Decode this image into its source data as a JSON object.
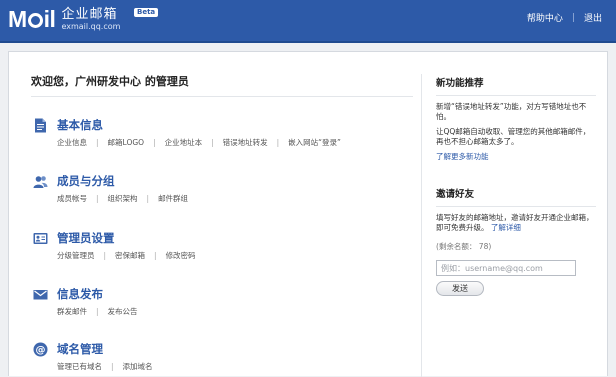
{
  "header": {
    "logo_domain": "exmail.qq.com",
    "logo_cn": "企业邮箱",
    "logo_mail": "M",
    "logo_mail_tail": "il",
    "beta": "Beta",
    "help_link": "帮助中心",
    "separator": "|",
    "logout_link": "退出"
  },
  "welcome": "欢迎您，广州研发中心 的管理员",
  "sections": [
    {
      "title": "基本信息",
      "icon": "document-icon",
      "links": [
        "企业信息",
        "邮箱LOGO",
        "企业地址本",
        "错误地址转发",
        "嵌入网站“登录”"
      ]
    },
    {
      "title": "成员与分组",
      "icon": "users-icon",
      "links": [
        "成员帐号",
        "组织架构",
        "邮件群组"
      ]
    },
    {
      "title": "管理员设置",
      "icon": "admin-card-icon",
      "links": [
        "分级管理员",
        "密保邮箱",
        "修改密码"
      ]
    },
    {
      "title": "信息发布",
      "icon": "envelope-icon",
      "links": [
        "群发邮件",
        "发布公告"
      ]
    },
    {
      "title": "域名管理",
      "icon": "at-sign-icon",
      "links": [
        "管理已有域名",
        "添加域名"
      ]
    }
  ],
  "new_features": {
    "title": "新功能推荐",
    "desc1": "新增“错误地址转发”功能，对方写错地址也不怕。",
    "desc2": "让QQ邮箱自动收取、管理您的其他邮箱邮件，再也不担心邮箱太多了。",
    "more_link": "了解更多新功能"
  },
  "invite": {
    "title": "邀请好友",
    "desc": "填写好友的邮箱地址，邀请好友开通企业邮箱，即可免费升级。",
    "detail_link": "了解详细",
    "remaining": "(剩余名额： 78)",
    "input_placeholder": "例如：username@qq.com",
    "send_label": "发送"
  },
  "colors": {
    "brand_blue": "#2d5aa8",
    "page_bg": "#eef0f3"
  }
}
